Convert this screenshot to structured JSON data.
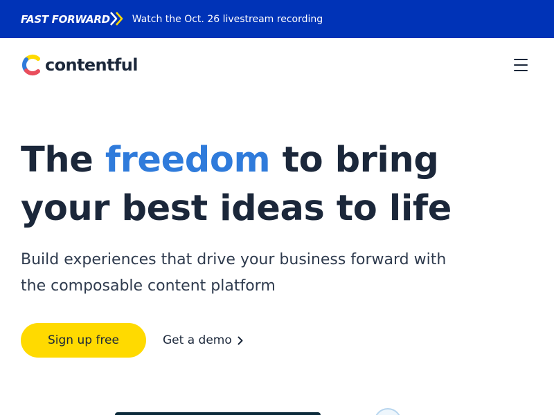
{
  "banner": {
    "logo_text": "FAST FORWARD",
    "link_text": "Watch the Oct. 26 livestream recording",
    "background": "#0033b7"
  },
  "nav": {
    "brand_name": "contentful",
    "logo_colors": [
      "#ffda00",
      "#2f7bdb",
      "#e94e5c"
    ],
    "menu_icon": "hamburger-menu-icon"
  },
  "hero": {
    "title_before": "The ",
    "title_accent": "freedom",
    "title_after": " to bring your best ideas to life",
    "subtitle": "Build experiences that drive your business forward with the composable content platform",
    "accent_color": "#2f7bdb",
    "primary_cta": "Sign up free",
    "secondary_cta": "Get a demo",
    "primary_cta_color": "#ffda00"
  }
}
